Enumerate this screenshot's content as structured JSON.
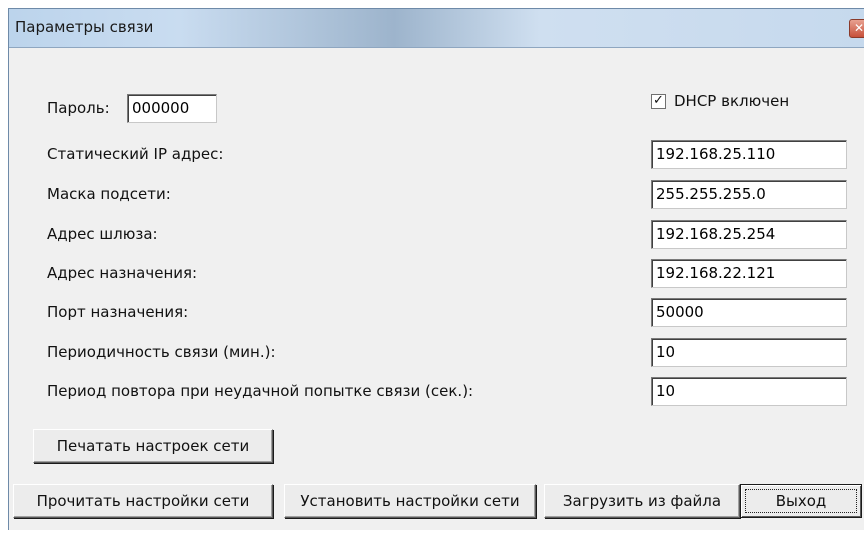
{
  "window": {
    "title": "Параметры связи"
  },
  "password": {
    "label": "Пароль:",
    "value": "000000"
  },
  "dhcp": {
    "label": "DHCP включен",
    "checked": true
  },
  "fields": [
    {
      "label": "Статический IP адрес:",
      "value": "192.168.25.110"
    },
    {
      "label": "Маска подсети:",
      "value": "255.255.255.0"
    },
    {
      "label": "Адрес шлюза:",
      "value": "192.168.25.254"
    },
    {
      "label": "Адрес назначения:",
      "value": "192.168.22.121"
    },
    {
      "label": "Порт назначения:",
      "value": "50000"
    },
    {
      "label": "Периодичность связи (мин.):",
      "value": "10"
    },
    {
      "label": "Период повтора при неудачной попытке связи (сек.):",
      "value": "10"
    }
  ],
  "buttons": {
    "print": "Печатать настроек сети",
    "read": "Прочитать настройки сети",
    "set": "Установить настройки сети",
    "load": "Загрузить из файла",
    "exit": "Выход"
  },
  "icons": {
    "close": "close-icon",
    "check": "checkmark-icon"
  }
}
